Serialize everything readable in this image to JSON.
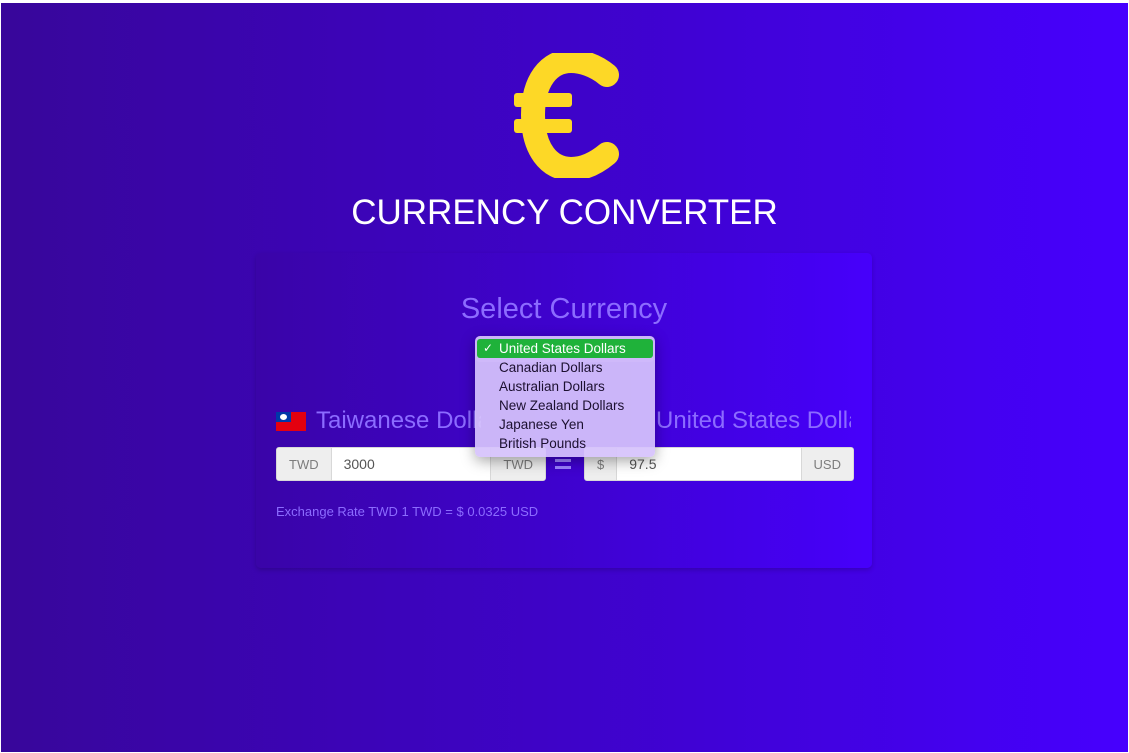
{
  "app": {
    "title": "CURRENCY CONVERTER",
    "logo_icon": "euro-icon",
    "logo_color": "#fdd826"
  },
  "converter": {
    "heading": "Select Currency",
    "from": {
      "label": "Taiwanese Dollars",
      "flag_icon": "taiwan-flag-icon",
      "code_prefix": "TWD",
      "amount": "3000",
      "code_suffix": "TWD"
    },
    "equals_icon": "equals-icon",
    "to": {
      "label": "United States Dollars",
      "symbol": "$",
      "amount": "97.5",
      "code_suffix": "USD"
    },
    "exchange_rate_text": "Exchange Rate TWD 1 TWD = $ 0.0325 USD"
  },
  "currency_dropdown": {
    "selected": "United States Dollars",
    "check_icon": "checkmark-icon",
    "check_glyph": "✓",
    "options": [
      {
        "label": "United States Dollars"
      },
      {
        "label": "Canadian Dollars"
      },
      {
        "label": "Australian Dollars"
      },
      {
        "label": "New Zealand Dollars"
      },
      {
        "label": "Japanese Yen"
      },
      {
        "label": "British Pounds"
      }
    ],
    "selected_color": "#1fb23a"
  },
  "colors": {
    "background_start": "#38069a",
    "background_end": "#4600fe",
    "accent_text": "#8c6cff"
  }
}
